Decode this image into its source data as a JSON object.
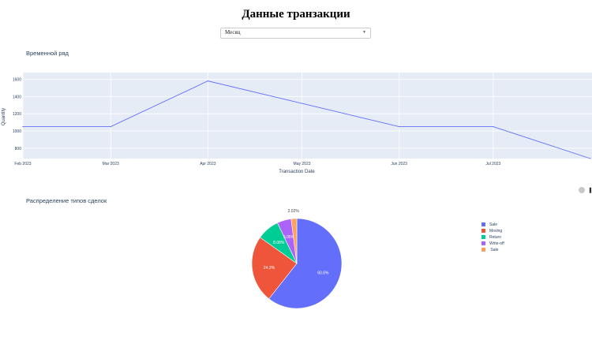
{
  "page": {
    "title": "Данные транзакции"
  },
  "dropdown": {
    "selected": "Месяц"
  },
  "timeseries": {
    "title": "Временной ряд"
  },
  "pie": {
    "title": "Распределение типов сделок"
  },
  "colors": {
    "line": "#636efa",
    "plot_bg": "#e5ecf6",
    "text": "#2a3f5f"
  },
  "icons": [
    "chevron-down-icon",
    "camera-icon"
  ],
  "chart_data": [
    {
      "type": "line",
      "title": "",
      "xlabel": "Transaction Date",
      "ylabel": "Quantity",
      "x": [
        "2023-02-01",
        "2023-03-01",
        "2023-04-01",
        "2023-05-01",
        "2023-06-01",
        "2023-07-01",
        "2023-08-01"
      ],
      "x_ticks": [
        "Feb 2023",
        "Mar 2023",
        "Apr 2023",
        "May 2023",
        "Jun 2023",
        "Jul 2023"
      ],
      "y": [
        1050,
        1050,
        1580,
        1320,
        1050,
        1050,
        680
      ],
      "y_ticks": [
        800,
        1000,
        1200,
        1400,
        1600
      ],
      "ylim": [
        680,
        1650
      ],
      "grid": true
    },
    {
      "type": "pie",
      "title": "",
      "legend_position": "right",
      "labels": [
        "Sale",
        "Moving",
        "Return",
        "Write-off",
        " Sale"
      ],
      "values": [
        60.6,
        24.2,
        8.08,
        5.05,
        2.02
      ],
      "display_labels": [
        "60.6%",
        "24.2%",
        "8.08%",
        "5.05%",
        "2.02%"
      ],
      "colors": [
        "#636efa",
        "#ef553b",
        "#00cc96",
        "#ab63fa",
        "#ffa15a"
      ]
    }
  ]
}
